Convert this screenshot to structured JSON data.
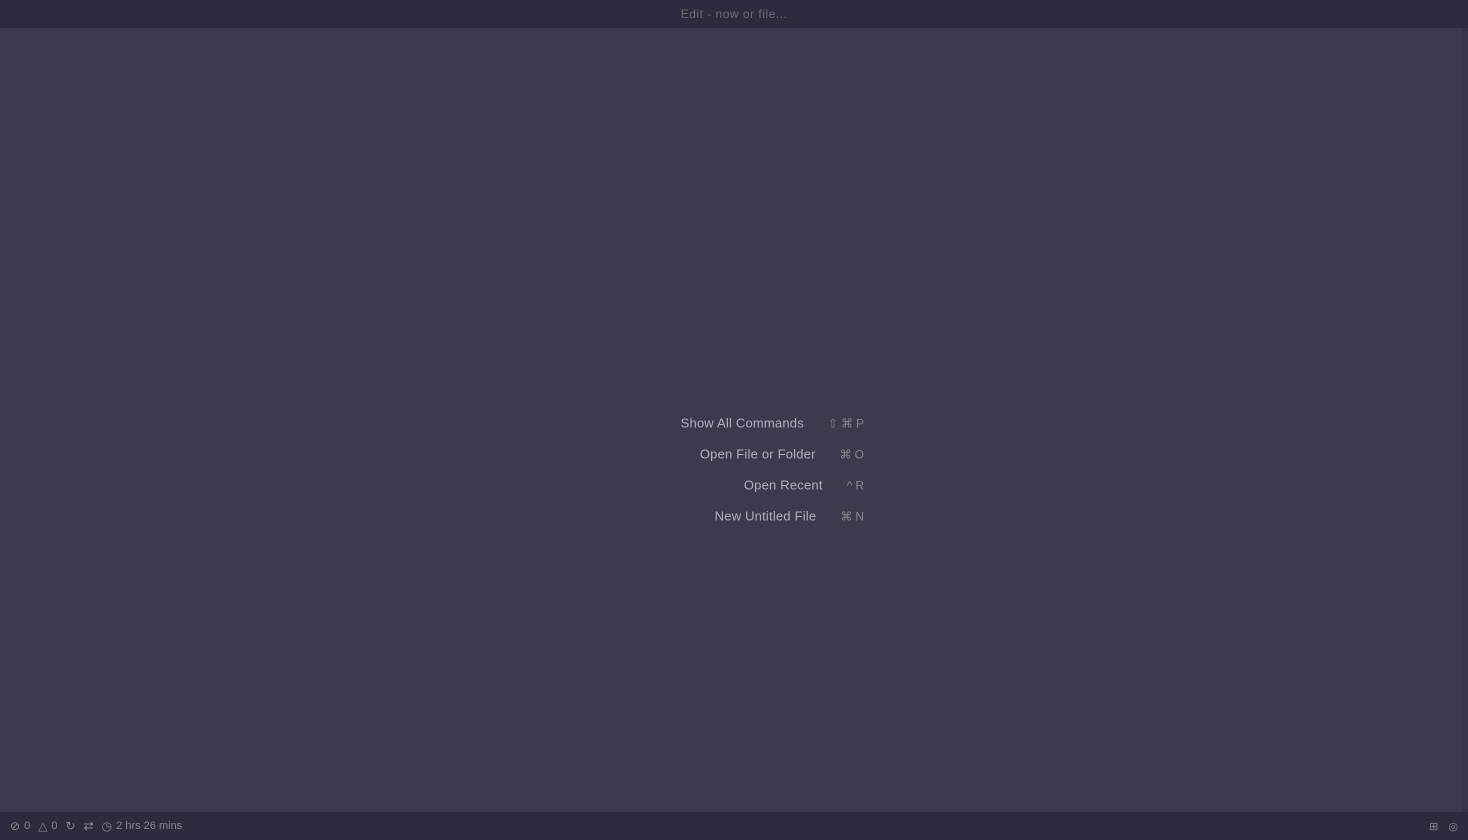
{
  "titleBar": {
    "title": "Edit - now or file..."
  },
  "menu": {
    "items": [
      {
        "id": "show-all-commands",
        "label": "Show All Commands",
        "shortcutParts": [
          "⇧",
          "⌘",
          "P"
        ]
      },
      {
        "id": "open-file-or-folder",
        "label": "Open File or Folder",
        "shortcutParts": [
          "⌘",
          "O"
        ]
      },
      {
        "id": "open-recent",
        "label": "Open Recent",
        "shortcutParts": [
          "^",
          "R"
        ]
      },
      {
        "id": "new-untitled-file",
        "label": "New Untitled File",
        "shortcutParts": [
          "⌘",
          "N"
        ]
      }
    ]
  },
  "statusBar": {
    "errors": "0",
    "warnings": "0",
    "timer": "2 hrs 26 mins",
    "icons": {
      "error": "⊘",
      "warning": "△",
      "refresh": "↻",
      "sync": "⇄",
      "clock": "◷"
    }
  }
}
